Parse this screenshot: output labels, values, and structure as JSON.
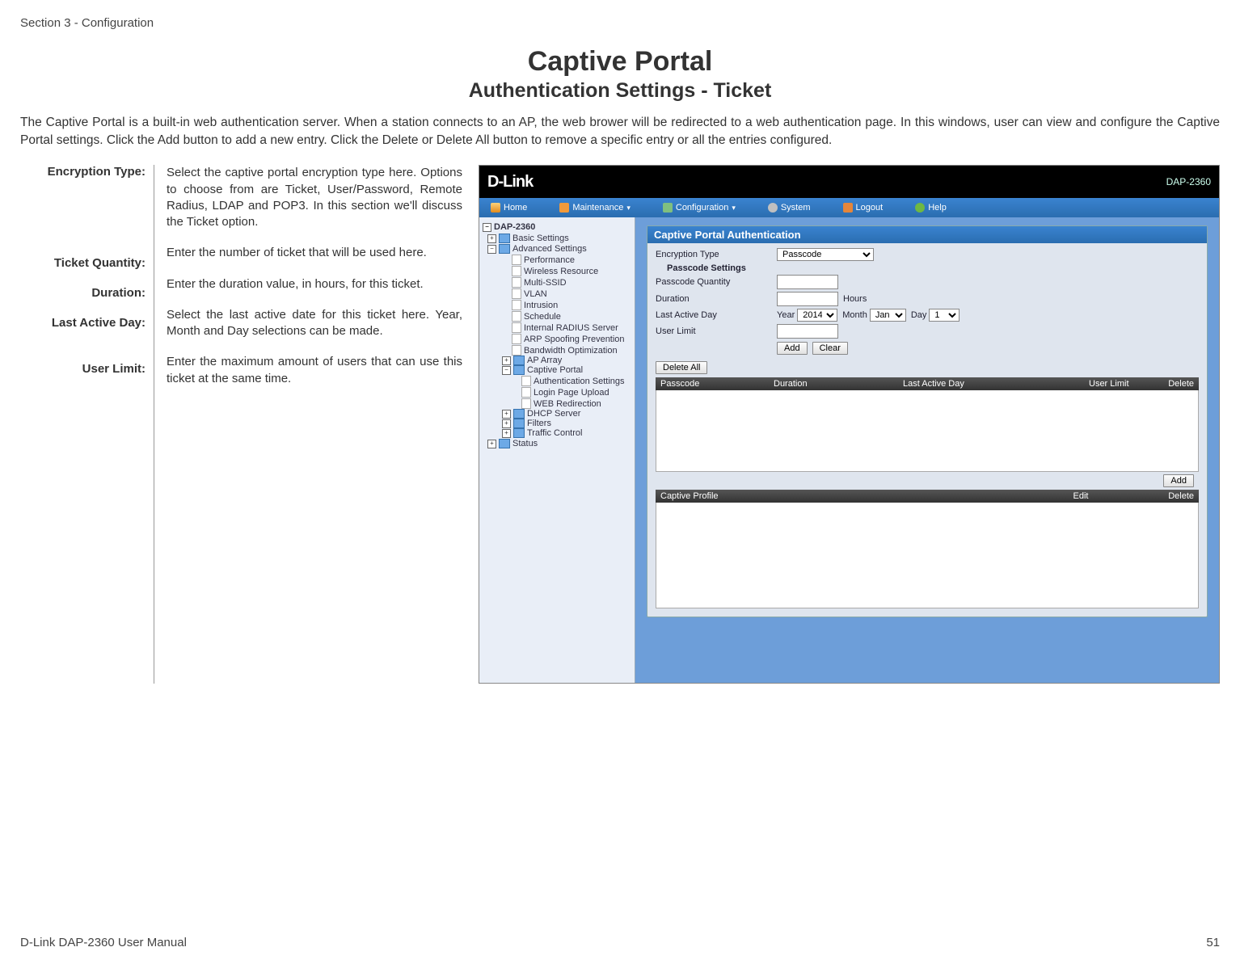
{
  "section_header": "Section 3 - Configuration",
  "page_title": "Captive Portal",
  "page_subtitle": "Authentication Settings - Ticket",
  "intro": "The Captive Portal is a built-in web authentication server. When a station connects to an AP, the web brower will be redirected to a web authentication page. In this windows, user can view and configure the Captive Portal settings. Click the Add button to add a new entry. Click the Delete or Delete All button to remove a specific entry or all the entries configured.",
  "defs": {
    "encryption_type": {
      "label": "Encryption Type:",
      "desc": "Select the captive portal encryption type here. Options to choose from are Ticket, User/Password, Remote Radius, LDAP and POP3. In this section we'll discuss the Ticket option."
    },
    "ticket_quantity": {
      "label": "Ticket Quantity:",
      "desc": "Enter the number of ticket that will be used here."
    },
    "duration": {
      "label": "Duration:",
      "desc": "Enter the duration value, in hours, for this ticket."
    },
    "last_active": {
      "label": "Last Active Day:",
      "desc": "Select the last active date for this ticket here. Year, Month and Day selections can be made."
    },
    "user_limit": {
      "label": "User Limit:",
      "desc": "Enter the maximum amount of users that can use this ticket at the same time."
    }
  },
  "screenshot": {
    "brand": "D-Link",
    "model": "DAP-2360",
    "menu": {
      "home": "Home",
      "maintenance": "Maintenance",
      "configuration": "Configuration",
      "system": "System",
      "logout": "Logout",
      "help": "Help"
    },
    "tree": {
      "root": "DAP-2360",
      "basic": "Basic Settings",
      "advanced": "Advanced Settings",
      "adv_items": [
        "Performance",
        "Wireless Resource",
        "Multi-SSID",
        "VLAN",
        "Intrusion",
        "Schedule",
        "Internal RADIUS Server",
        "ARP Spoofing Prevention",
        "Bandwidth Optimization"
      ],
      "ap_array": "AP Array",
      "captive": "Captive Portal",
      "captive_items": [
        "Authentication Settings",
        "Login Page Upload",
        "WEB Redirection"
      ],
      "dhcp": "DHCP Server",
      "filters": "Filters",
      "traffic": "Traffic Control",
      "status": "Status"
    },
    "panel": {
      "title": "Captive Portal Authentication",
      "enc_label": "Encryption Type",
      "enc_value": "Passcode",
      "sub_heading": "Passcode Settings",
      "qty_label": "Passcode Quantity",
      "dur_label": "Duration",
      "dur_unit": "Hours",
      "last_label": "Last Active Day",
      "year_lbl": "Year",
      "year_val": "2014",
      "month_lbl": "Month",
      "month_val": "Jan",
      "day_lbl": "Day",
      "day_val": "1",
      "limit_label": "User Limit",
      "add_btn": "Add",
      "clear_btn": "Clear",
      "del_all_btn": "Delete All",
      "cols": {
        "passcode": "Passcode",
        "duration": "Duration",
        "lastday": "Last Active Day",
        "userlimit": "User Limit",
        "delete": "Delete"
      },
      "add_btn2": "Add",
      "cols2": {
        "profile": "Captive Profile",
        "edit": "Edit",
        "delete": "Delete"
      }
    }
  },
  "footer_left": "D-Link DAP-2360 User Manual",
  "footer_right": "51"
}
